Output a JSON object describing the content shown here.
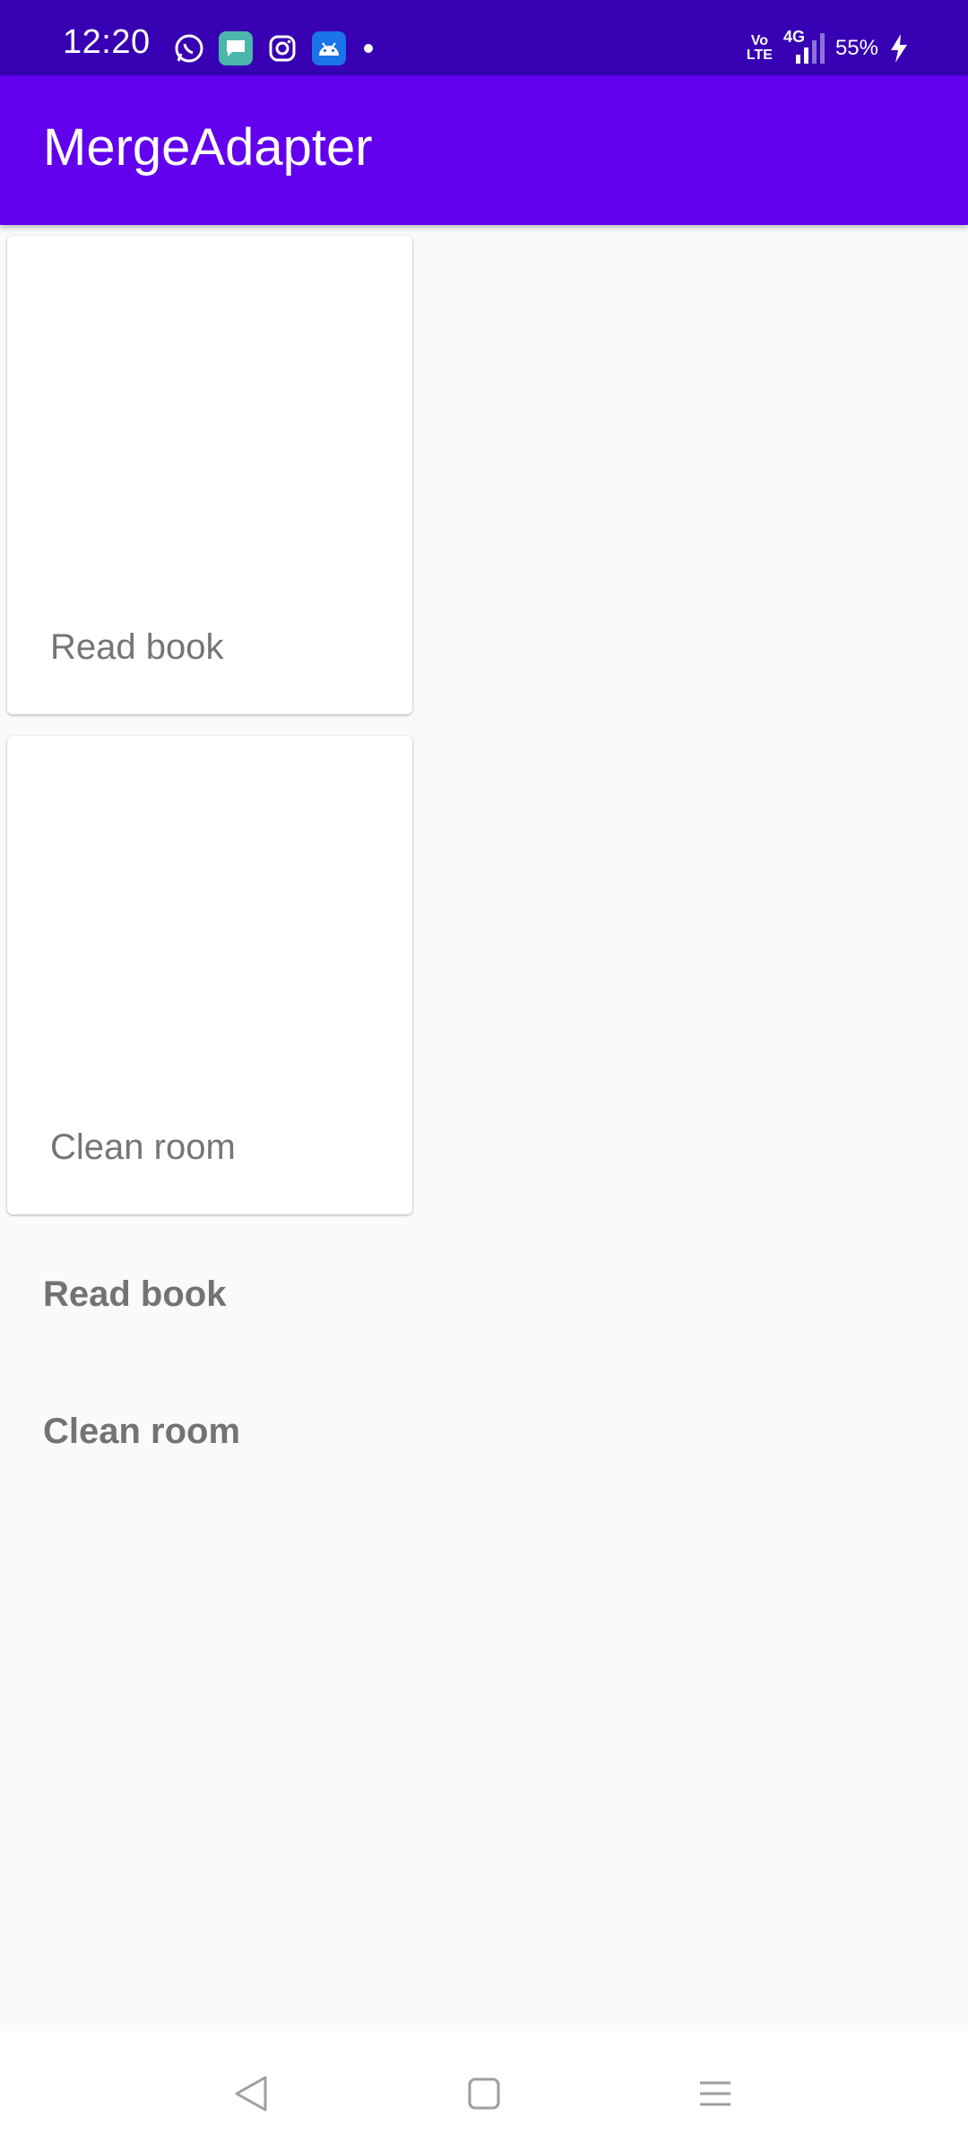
{
  "status_bar": {
    "time": "12:20",
    "notification_icons": [
      "whatsapp-icon",
      "messages-icon",
      "instagram-icon",
      "android-icon"
    ],
    "network_label": "Vo LTE",
    "signal_label": "4G",
    "battery": "55%"
  },
  "app_bar": {
    "title": "MergeAdapter",
    "color": "#6200ee",
    "status_color": "#3700b3"
  },
  "cards": [
    {
      "label": "Read book"
    },
    {
      "label": "Clean room"
    }
  ],
  "text_items": [
    {
      "label": "Read book"
    },
    {
      "label": "Clean room"
    }
  ],
  "nav_bar": {
    "buttons": [
      "back-icon",
      "home-icon",
      "menu-icon"
    ]
  }
}
